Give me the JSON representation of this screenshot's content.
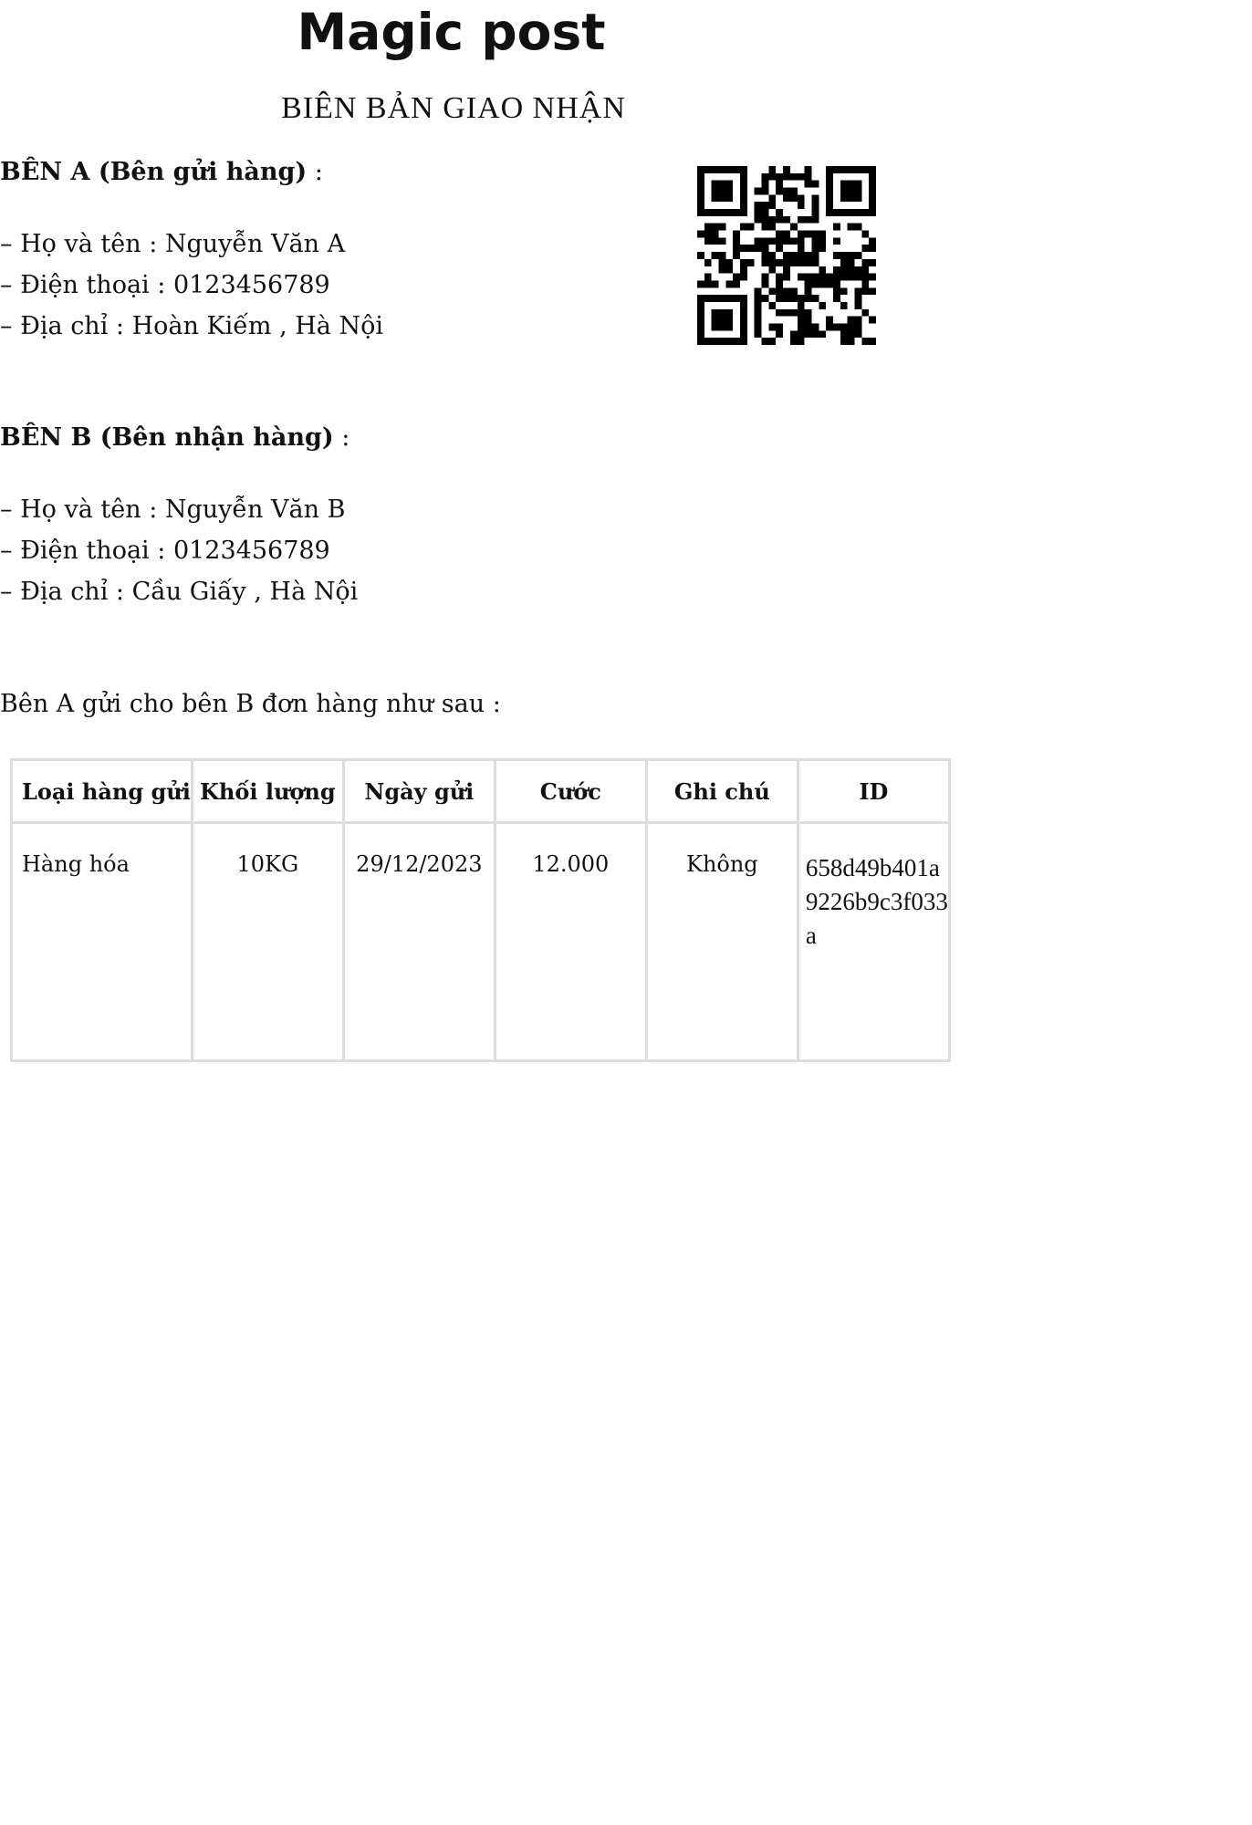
{
  "header": {
    "brand": "Magic post",
    "title": "BIÊN BẢN GIAO NHẬN"
  },
  "party_a": {
    "heading_bold": "BÊN A (Bên gửi hàng)",
    "heading_suffix": " :",
    "name": "– Họ và tên : Nguyễn Văn A",
    "phone": "– Điện thoại : 0123456789",
    "address": "– Địa chỉ : Hoàn Kiếm , Hà Nội"
  },
  "party_b": {
    "heading_bold": "BÊN B (Bên nhận hàng)",
    "heading_suffix": " :",
    "name": "– Họ và tên : Nguyễn Văn B",
    "phone": "– Điện thoại : 0123456789",
    "address": "– Địa chỉ : Cầu Giấy , Hà Nội"
  },
  "intro": "Bên A gửi cho bên B đơn hàng như sau :",
  "table": {
    "headers": [
      "Loại hàng gửi",
      "Khối lượng",
      "Ngày gửi",
      "Cước",
      "Ghi chú",
      "ID"
    ],
    "row": {
      "type": "Hàng hóa",
      "weight": "10KG",
      "date": "29/12/2023",
      "fee": "12.000",
      "note": "Không",
      "id": "658d49b401a9226b9c3f033a"
    }
  },
  "qr_code": {
    "icon": "qr-code-icon",
    "color": "#000000"
  }
}
